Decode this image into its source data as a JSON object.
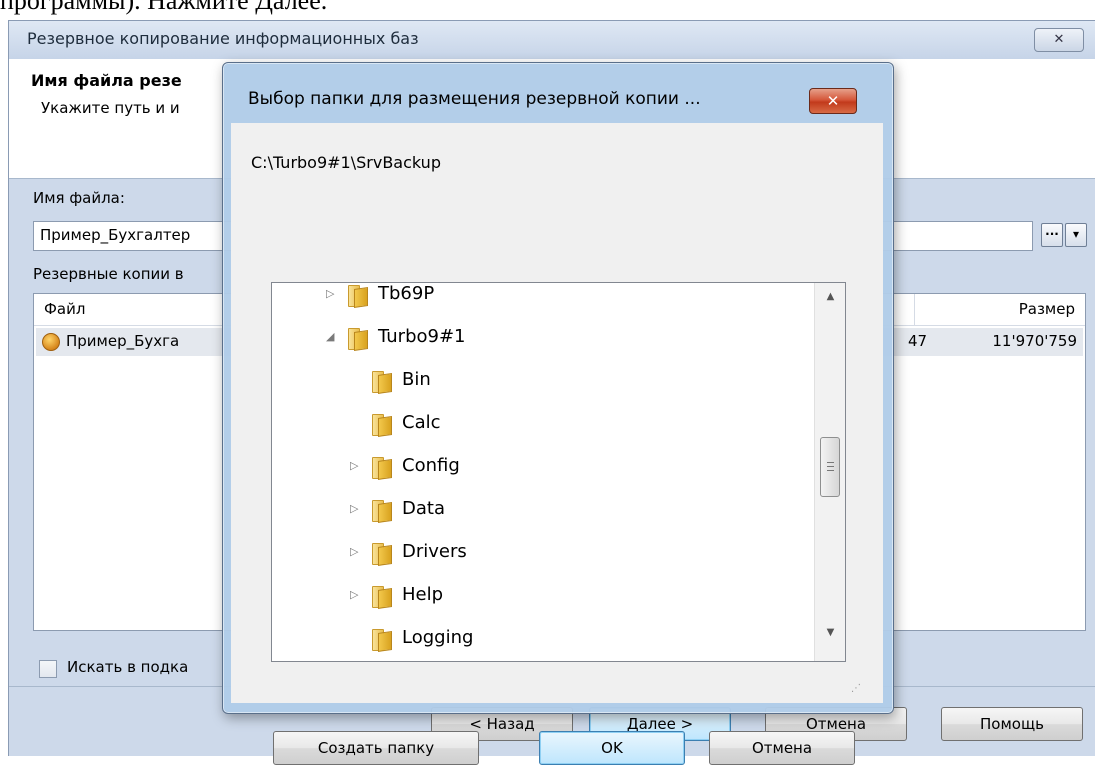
{
  "top_text": "программы). Нажмите Далее.",
  "wizard": {
    "title": "Резервное копирование информационных баз",
    "close_label": "✕",
    "header_title": "Имя файла резе",
    "header_subtitle": "Укажите путь и и",
    "file_name_label": "Имя файла:",
    "file_name_value": "Пример_Бухгалтер",
    "backups_label": "Резервные копии в",
    "browse_label": "···",
    "dropdown_label": "▾",
    "columns": {
      "file": "Файл",
      "size": "Размер"
    },
    "row": {
      "name": "Пример_Бухга",
      "date_fragment": "47",
      "size": "11'970'759"
    },
    "search_subfolders_label": "Искать в подка",
    "buttons": {
      "back": "< Назад",
      "next": "Далее >",
      "cancel": "Отмена",
      "help": "Помощь"
    }
  },
  "dialog": {
    "title": "Выбор папки для размещения резервной копии ...",
    "close_label": "✕",
    "path": "C:\\Turbo9#1\\SrvBackup",
    "tree": [
      {
        "name": "Tb69P",
        "expanded": false,
        "has_children": true
      },
      {
        "name": "Turbo9#1",
        "expanded": true,
        "has_children": true
      },
      {
        "name": "Bin",
        "has_children": false
      },
      {
        "name": "Calc",
        "has_children": false
      },
      {
        "name": "Config",
        "has_children": true
      },
      {
        "name": "Data",
        "has_children": true
      },
      {
        "name": "Drivers",
        "has_children": true
      },
      {
        "name": "Help",
        "has_children": true
      },
      {
        "name": "Logging",
        "has_children": false
      }
    ],
    "buttons": {
      "new_folder": "Создать папку",
      "ok": "OK",
      "cancel": "Отмена"
    }
  }
}
